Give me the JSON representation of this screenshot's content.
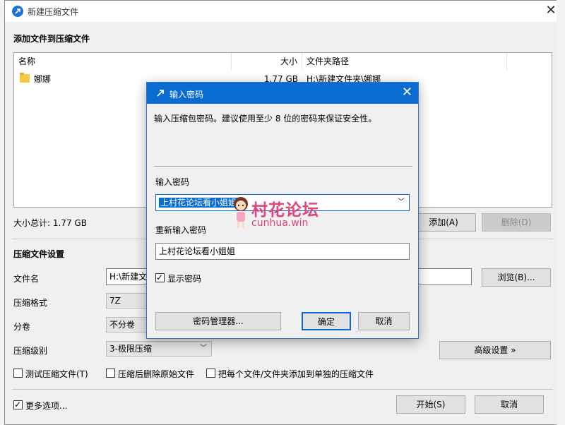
{
  "main_window": {
    "title": "新建压缩文件",
    "add_section_title": "添加文件到压缩文件",
    "columns": [
      "名称",
      "大小",
      "文件夹路径"
    ],
    "rows": [
      {
        "name": "娜娜",
        "size": "1.77 GB",
        "path": "H:\\新建文件夹\\娜娜"
      }
    ],
    "total_size": "大小总计: 1.77 GB",
    "add_button": "添加(A)",
    "delete_button": "删除(D)",
    "settings_title": "压缩文件设置",
    "filename_label": "文件名",
    "filename_value": "H:\\新建文",
    "browse_button": "浏览(B)...",
    "format_label": "压缩格式",
    "format_value": "7Z",
    "volume_label": "分卷",
    "volume_value": "不分卷",
    "level_label": "压缩级别",
    "level_value": "3-极限压缩",
    "advanced_button": "高级设置 »",
    "test_checkbox": "测试压缩文件(T)",
    "delete_after_checkbox": "压缩后删除原始文件",
    "separate_checkbox": "把每个文件/文件夹添加到单独的压缩文件",
    "more_options": "更多选项...",
    "start_button": "开始(S)",
    "cancel_button": "取消"
  },
  "dialog": {
    "title": "输入密码",
    "hint": "输入压缩包密码。建议使用至少 8 位的密码来保证安全性。",
    "password_label": "输入密码",
    "password_value": "上村花论坛看小姐姐",
    "reenter_label": "重新输入密码",
    "reenter_value": "上村花论坛看小姐姐",
    "show_password": "显示密码",
    "manager_button": "密码管理器...",
    "ok_button": "确定",
    "cancel_button": "取消"
  },
  "watermark": {
    "name": "村花论坛",
    "url": "cunhua.win"
  },
  "colors": {
    "dialog_title_bg": "#0a6cd1",
    "app_icon": "#1a73d9",
    "watermark": "#e0457b",
    "folder": "#f5c842"
  }
}
